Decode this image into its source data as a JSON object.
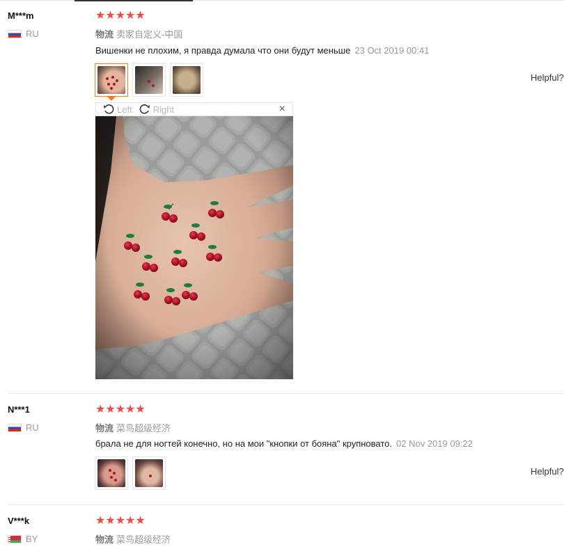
{
  "reviews": [
    {
      "user": "M***m",
      "country": "RU",
      "stars": "★★★★★",
      "logistics_label": "物流",
      "logistics_value": "卖家自定义-中国",
      "text": "Вишенки не плохим, я правда думала что они будут меньше",
      "date": "23 Oct 2019 00:41",
      "helpful": "Helpful?"
    },
    {
      "user": "N***1",
      "country": "RU",
      "stars": "★★★★★",
      "logistics_label": "物流",
      "logistics_value": "菜鸟超级经济",
      "text": "брала не для ногтей конечно, но на мои \"кнопки от бояна\" крупновато.",
      "date": "02 Nov 2019 09:22",
      "helpful": "Helpful?"
    },
    {
      "user": "V***k",
      "country": "BY",
      "stars": "★★★★★",
      "logistics_label": "物流",
      "logistics_value": "菜鸟超级经济"
    }
  ],
  "viewer": {
    "rotate_left": "Left",
    "rotate_right": "Right",
    "close": "×"
  },
  "icons": {
    "rotate_left": "rotate-left-icon",
    "rotate_right": "rotate-right-icon",
    "close": "close-icon",
    "star": "star-icon"
  },
  "colors": {
    "star": "#f04a45",
    "active_thumb": "#ff7a1a"
  }
}
